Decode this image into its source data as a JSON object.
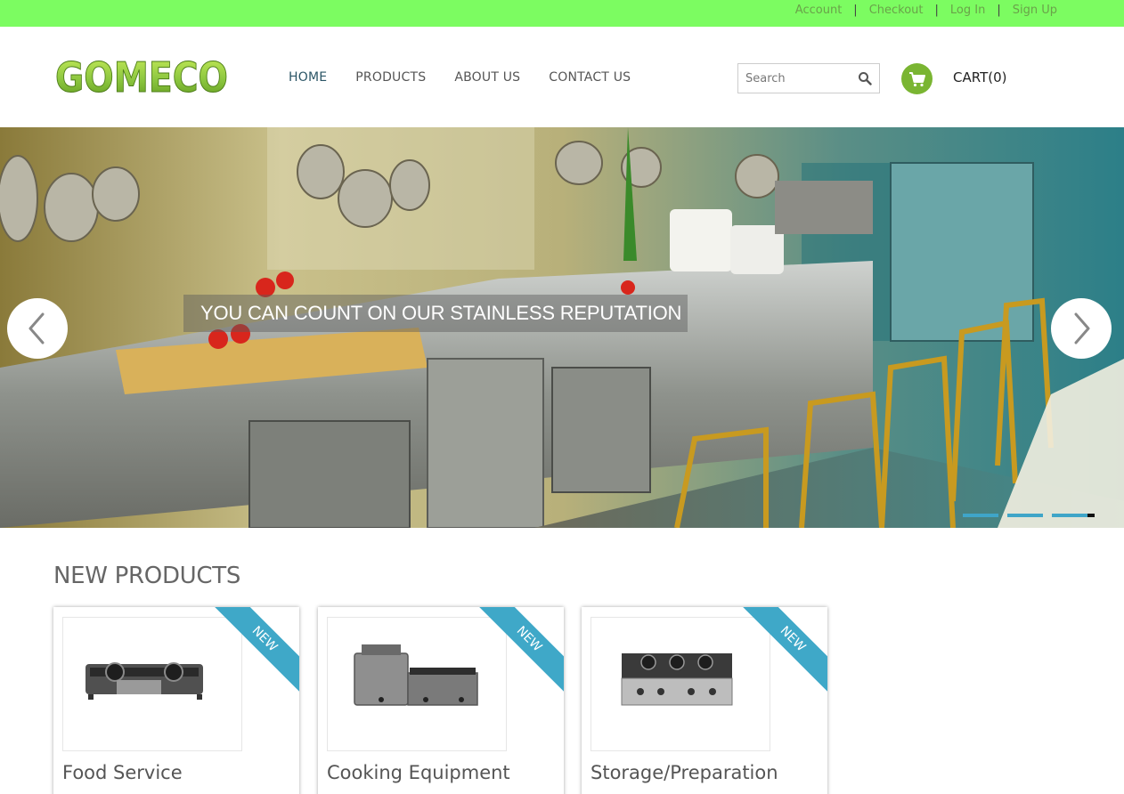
{
  "top_links": [
    "Account",
    "Checkout",
    "Log In",
    "Sign Up"
  ],
  "top_separator": "|",
  "logo": {
    "text": "GOMECO"
  },
  "nav": [
    {
      "label": "HOME",
      "active": true
    },
    {
      "label": "PRODUCTS",
      "active": false
    },
    {
      "label": "ABOUT US",
      "active": false
    },
    {
      "label": "CONTACT US",
      "active": false
    }
  ],
  "search": {
    "placeholder": "Search",
    "icon": "search-icon"
  },
  "cart": {
    "label": "CART(0)",
    "icon": "cart-icon"
  },
  "hero": {
    "caption": "YOU CAN COUNT ON OUR STAINLESS REPUTATION",
    "prev_icon": "chevron-left-icon",
    "next_icon": "chevron-right-icon",
    "slide_count": 4,
    "active_slide": 4
  },
  "new_products": {
    "title": "NEW PRODUCTS",
    "badge": "NEW",
    "items": [
      {
        "name": "Food Service"
      },
      {
        "name": "Cooking Equipment"
      },
      {
        "name": "Storage/Preparation"
      }
    ]
  },
  "colors": {
    "topbar": "#7cfc61",
    "brand_green": "#7ab532",
    "ribbon_blue": "#3fa8c8",
    "nav_active": "#2b5566"
  }
}
